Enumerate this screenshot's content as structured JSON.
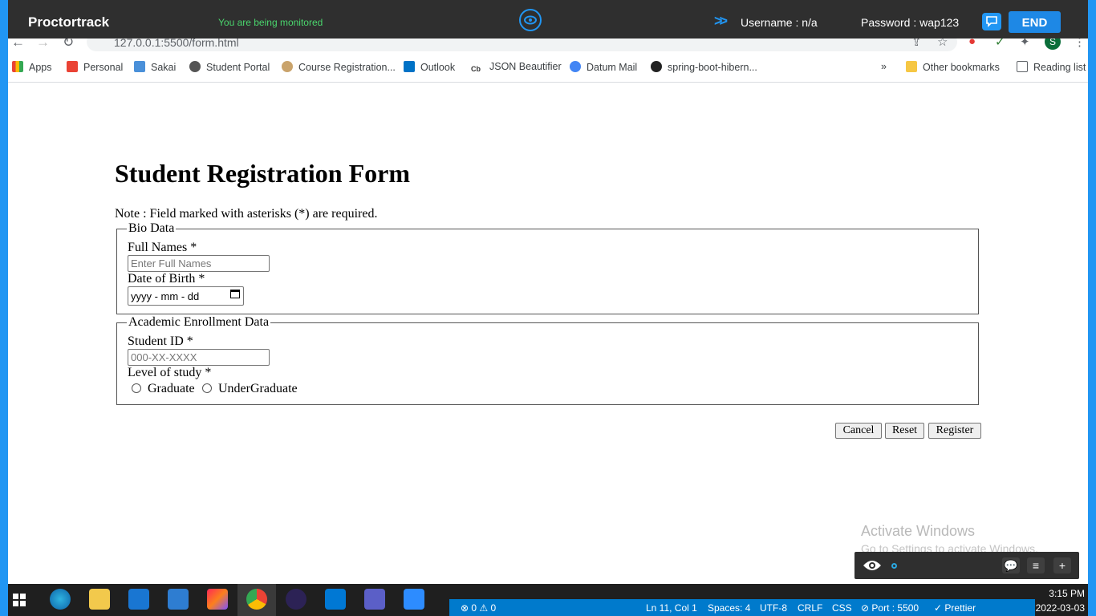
{
  "proctor": {
    "brand": "Proctortrack",
    "monitor_text": "You are being monitored",
    "username": "Username : n/a",
    "password": "Password : wap123",
    "end_label": "END"
  },
  "browser": {
    "url": "127.0.0.1:5500/form.html",
    "avatar_letter": "S"
  },
  "bookmarks": [
    {
      "label": "Apps",
      "color": "#ea4335"
    },
    {
      "label": "Personal",
      "color": "#ea4335"
    },
    {
      "label": "Sakai",
      "color": "#4a90d9"
    },
    {
      "label": "Student Portal",
      "color": "#555555"
    },
    {
      "label": "Course Registration...",
      "color": "#c9a36b"
    },
    {
      "label": "Outlook",
      "color": "#0072c6"
    },
    {
      "label": "JSON Beautifier",
      "color": "#333333"
    },
    {
      "label": "Datum Mail",
      "color": "#4285f4"
    },
    {
      "label": "spring-boot-hibern...",
      "color": "#222222"
    }
  ],
  "bookmarks_right": {
    "more": "»",
    "other": "Other bookmarks",
    "reading": "Reading list"
  },
  "form": {
    "title": "Student Registration Form",
    "note": "Note : Field marked with asterisks (*) are required.",
    "bio": {
      "legend": "Bio Data",
      "full_names_label": "Full Names *",
      "full_names_placeholder": "Enter Full Names",
      "dob_label": "Date of Birth *",
      "dob_value": "yyyy - mm - dd"
    },
    "academic": {
      "legend": "Academic Enrollment Data",
      "student_id_label": "Student ID *",
      "student_id_placeholder": "000-XX-XXXX",
      "level_label": "Level of study *",
      "options": [
        "Graduate",
        "UnderGraduate"
      ]
    },
    "buttons": {
      "cancel": "Cancel",
      "reset": "Reset",
      "register": "Register"
    }
  },
  "activate_windows": {
    "line1": "Activate Windows",
    "line2": "Go to Settings to activate Windows."
  },
  "vscode_status": {
    "problems": "⊗ 0 ⚠ 0",
    "position": "Ln 11, Col 1",
    "spaces": "Spaces: 4",
    "encoding": "UTF-8",
    "eol": "CRLF",
    "lang": "CSS",
    "port": "⊘ Port : 5500",
    "prettier": "✓ Prettier"
  },
  "clock": {
    "time": "3:15 PM",
    "date": "2022-03-03"
  }
}
